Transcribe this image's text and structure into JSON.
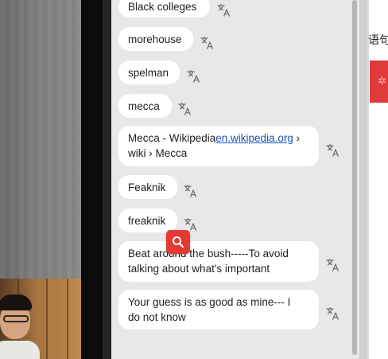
{
  "chat": {
    "messages": [
      {
        "text": "Black colleges"
      },
      {
        "text": "morehouse"
      },
      {
        "text": "spelman"
      },
      {
        "text": "mecca"
      },
      {
        "line1_text": "Mecca - Wikipedia",
        "line1_link": "en.wikipedia.org",
        "line1_suffix": " ›",
        "line2": "wiki › Mecca"
      },
      {
        "text": "Feaknik"
      },
      {
        "text": "freaknik"
      },
      {
        "line1": "Beat around the bush-----To avoid",
        "line2": "talking about what's important"
      },
      {
        "line1": "Your guess is as good as mine--- I",
        "line2": "do not know"
      }
    ],
    "translate_icon": "translate-icon",
    "search_icon": "search-icon"
  },
  "right_window": {
    "partial_text": "语句"
  },
  "colors": {
    "panel_bg": "#e8e8e8",
    "bubble_bg": "#ffffff",
    "link": "#1a55b8",
    "search_fab": "#e53935"
  }
}
